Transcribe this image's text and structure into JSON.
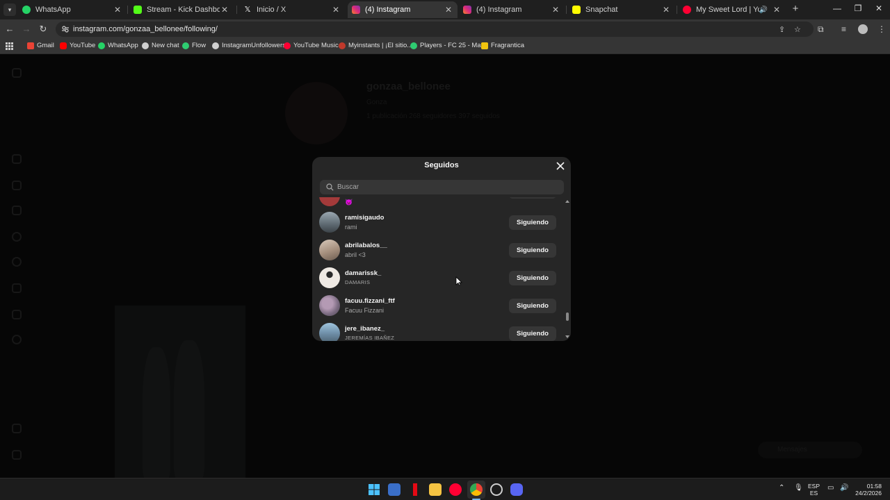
{
  "browser": {
    "tabs": [
      {
        "title": "WhatsApp",
        "favicon_color": "#25d366"
      },
      {
        "title": "Stream - Kick Dashboard",
        "favicon_color": "#53fc18"
      },
      {
        "title": "Inicio / X",
        "favicon_color": "#ffffff"
      },
      {
        "title": "(4) Instagram",
        "favicon_color": "#e1306c",
        "active": true
      },
      {
        "title": "(4) Instagram",
        "favicon_color": "#e1306c"
      },
      {
        "title": "Snapchat",
        "favicon_color": "#fffc00"
      },
      {
        "title": "My Sweet Lord | YouTube M",
        "favicon_color": "#ff0033"
      }
    ],
    "url": "instagram.com/gonzaa_bellonee/following/",
    "bookmarks": [
      {
        "label": "Gmail",
        "color": "#ea4335"
      },
      {
        "label": "YouTube",
        "color": "#ff0000"
      },
      {
        "label": "WhatsApp",
        "color": "#25d366"
      },
      {
        "label": "New chat",
        "color": "#cfcfcf"
      },
      {
        "label": "Flow",
        "color": "#2ecc71"
      },
      {
        "label": "InstagramUnfollowers",
        "color": "#cfcfcf"
      },
      {
        "label": "YouTube Music",
        "color": "#ff0033"
      },
      {
        "label": "Myinstants | ¡El sitio...",
        "color": "#c0392b"
      },
      {
        "label": "Players - FC 25 - Ma...",
        "color": "#2ecc71"
      },
      {
        "label": "Fragrantica",
        "color": "#f1c40f"
      }
    ]
  },
  "profile": {
    "username": "gonzaa_bellonee",
    "name": "Gonza",
    "stats": "1 publicación    268 seguidores    397 seguidos",
    "messages_label": "Mensajes"
  },
  "modal": {
    "title": "Seguidos",
    "search_placeholder": "Buscar",
    "partial_top_emoji": "😈",
    "rows": [
      {
        "username": "ramisigaudo",
        "name": "rami",
        "button": "Siguiendo",
        "avatar_color": "#6b7a86"
      },
      {
        "username": "abrilabalos__",
        "name": "abril <3",
        "button": "Siguiendo",
        "avatar_color": "#b8a89a"
      },
      {
        "username": "damarissk_",
        "name": "DAMARIS",
        "button": "Siguiendo",
        "avatar_color": "#d9d3cc"
      },
      {
        "username": "facuu.fizzani_ftf",
        "name": "Facuu Fizzani",
        "button": "Siguiendo",
        "avatar_color": "#8d7f8f"
      },
      {
        "username": "jere_ibanez_",
        "name": "JEREMÍAS IBAÑEZ",
        "button": "Siguiendo",
        "avatar_color": "#6f8fa8"
      }
    ]
  },
  "taskbar": {
    "language": "ESP",
    "region": "ES",
    "time": "01:58",
    "date": "24/2/2026"
  }
}
